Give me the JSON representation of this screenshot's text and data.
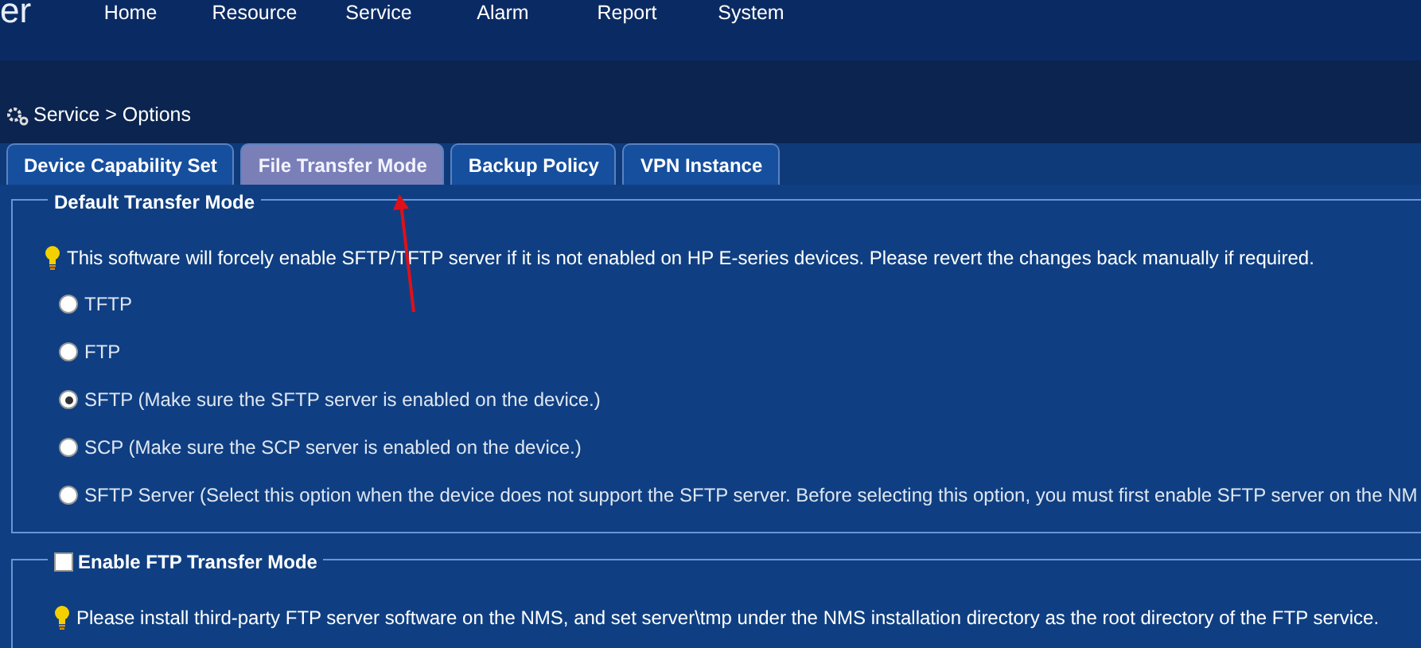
{
  "logo_text": "er",
  "nav": [
    {
      "label": "Home"
    },
    {
      "label": "Resource"
    },
    {
      "label": "Service"
    },
    {
      "label": "Alarm"
    },
    {
      "label": "Report"
    },
    {
      "label": "System"
    }
  ],
  "breadcrumb": "Service > Options",
  "tabs": [
    {
      "label": "Device Capability Set",
      "selected": false
    },
    {
      "label": "File Transfer Mode",
      "selected": true
    },
    {
      "label": "Backup Policy",
      "selected": false
    },
    {
      "label": "VPN Instance",
      "selected": false
    }
  ],
  "default_transfer_mode": {
    "title": "Default Transfer Mode",
    "tip": "This software will forcely enable SFTP/TFTP server if it is not enabled on HP E-series devices. Please revert the changes back manually if required.",
    "options": [
      {
        "label": "TFTP",
        "selected": false
      },
      {
        "label": "FTP",
        "selected": false
      },
      {
        "label": "SFTP (Make sure the SFTP server is enabled on the device.)",
        "selected": true
      },
      {
        "label": "SCP (Make sure the SCP server is enabled on the device.)",
        "selected": false
      },
      {
        "label": "SFTP Server (Select this option when the device does not support the SFTP server. Before selecting this option, you must first enable SFTP server on the NM",
        "selected": false
      }
    ]
  },
  "ftp_transfer_mode": {
    "title": "Enable FTP Transfer Mode",
    "checked": false,
    "tip": "Please install third-party FTP server software on the NMS, and set server\\tmp under the NMS installation directory as the root directory of the FTP service."
  }
}
